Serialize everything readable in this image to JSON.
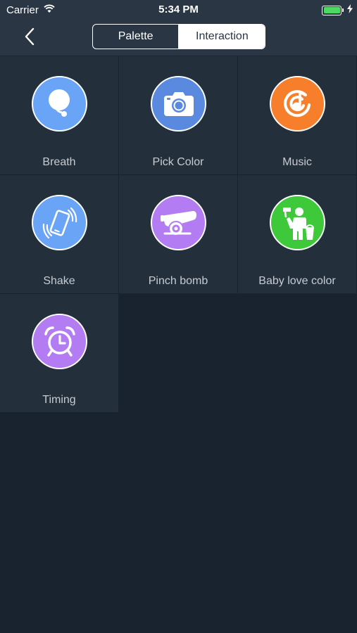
{
  "status_bar": {
    "carrier": "Carrier",
    "time": "5:34 PM",
    "battery_level": 1.0
  },
  "nav": {
    "back_icon": "chevron-left-icon",
    "tabs": [
      {
        "label": "Palette",
        "selected": false
      },
      {
        "label": "Interaction",
        "selected": true
      }
    ]
  },
  "items": [
    {
      "label": "Breath",
      "icon": "breath-bubble-icon",
      "color": "#6aa4f6"
    },
    {
      "label": "Pick Color",
      "icon": "camera-icon",
      "color": "#5a8ae0"
    },
    {
      "label": "Music",
      "icon": "music-note-icon",
      "color": "#f77f2b"
    },
    {
      "label": "Shake",
      "icon": "phone-shake-icon",
      "color": "#6aa4f6"
    },
    {
      "label": "Pinch bomb",
      "icon": "cannon-icon",
      "color": "#b47cf2"
    },
    {
      "label": "Baby love color",
      "icon": "child-painting-icon",
      "color": "#3dc93a"
    },
    {
      "label": "Timing",
      "icon": "alarm-clock-icon",
      "color": "#b47cf2"
    }
  ],
  "colors": {
    "background": "#18232f",
    "topbar": "#2a3644",
    "tile": "#232f3b",
    "label": "#c7ccd2"
  }
}
